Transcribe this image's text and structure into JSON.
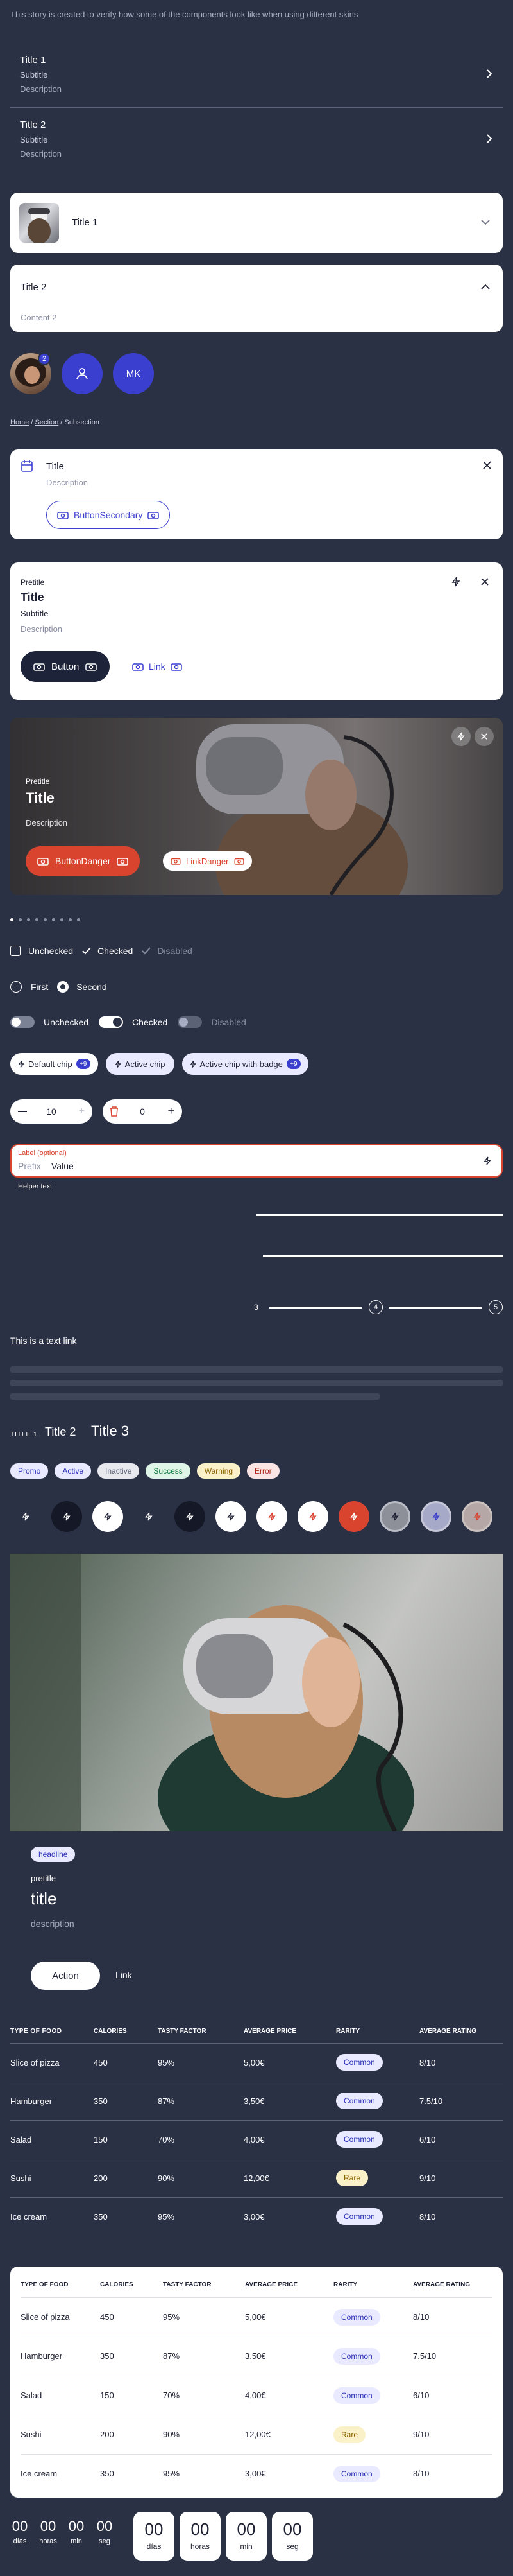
{
  "intro": "This story is created to verify how some of the components look like when using different skins",
  "list_items": [
    {
      "title": "Title 1",
      "subtitle": "Subtitle",
      "description": "Description"
    },
    {
      "title": "Title 2",
      "subtitle": "Subtitle",
      "description": "Description"
    }
  ],
  "accordion_1": {
    "title": "Title 1"
  },
  "accordion_2": {
    "title": "Title 2",
    "content": "Content 2"
  },
  "avatars": {
    "badge": "2",
    "initials": "MK"
  },
  "breadcrumb": {
    "home": "Home",
    "section": "Section",
    "current": "Subsection",
    "sep": "/"
  },
  "callout": {
    "title": "Title",
    "description": "Description",
    "button": "ButtonSecondary"
  },
  "card_white": {
    "pretitle": "Pretitle",
    "title": "Title",
    "subtitle": "Subtitle",
    "description": "Description",
    "button": "Button",
    "link": "Link"
  },
  "card_image": {
    "pretitle": "Pretitle",
    "title": "Title",
    "description": "Description",
    "button": "ButtonDanger",
    "link": "LinkDanger"
  },
  "checkboxes": [
    {
      "label": "Unchecked"
    },
    {
      "label": "Checked"
    },
    {
      "label": "Disabled"
    }
  ],
  "radios": [
    {
      "label": "First"
    },
    {
      "label": "Second"
    }
  ],
  "switches": [
    {
      "label": "Unchecked"
    },
    {
      "label": "Checked"
    },
    {
      "label": "Disabled"
    }
  ],
  "chips": [
    {
      "label": "Default chip",
      "badge": "+9"
    },
    {
      "label": "Active chip"
    },
    {
      "label": "Active chip with badge",
      "badge": "+9"
    }
  ],
  "steppers": [
    {
      "value": "10"
    },
    {
      "value": "0"
    }
  ],
  "text_field": {
    "label": "Label (optional)",
    "prefix": "Prefix",
    "value": "Value",
    "helper": "Helper text"
  },
  "step_numbers": [
    "3",
    "4",
    "5"
  ],
  "text_link": "This is a text link",
  "titles": {
    "t1": "TITLE 1",
    "t2": "Title 2",
    "t3": "Title 3"
  },
  "tags": [
    {
      "label": "Promo",
      "bg": "#e9eaff",
      "fg": "#2a30b8"
    },
    {
      "label": "Active",
      "bg": "#e9eaff",
      "fg": "#2a30b8"
    },
    {
      "label": "Inactive",
      "bg": "#e7e9ef",
      "fg": "#5c6276"
    },
    {
      "label": "Success",
      "bg": "#dff5e8",
      "fg": "#137a3f"
    },
    {
      "label": "Warning",
      "bg": "#fbf1c8",
      "fg": "#8a6400"
    },
    {
      "label": "Error",
      "bg": "#fbe4e4",
      "fg": "#b1261f"
    }
  ],
  "media_card": {
    "headline": "headline",
    "pretitle": "pretitle",
    "title": "title",
    "description": "description",
    "button": "Action",
    "link": "Link"
  },
  "table": {
    "headers": [
      "TYPE OF FOOD",
      "CALORIES",
      "TASTY FACTOR",
      "AVERAGE PRICE",
      "RARITY",
      "AVERAGE RATING"
    ],
    "rows": [
      [
        "Slice of pizza",
        "450",
        "95%",
        "5,00€",
        "Common",
        "8/10"
      ],
      [
        "Hamburger",
        "350",
        "87%",
        "3,50€",
        "Common",
        "7.5/10"
      ],
      [
        "Salad",
        "150",
        "70%",
        "4,00€",
        "Common",
        "6/10"
      ],
      [
        "Sushi",
        "200",
        "90%",
        "12,00€",
        "Rare",
        "9/10"
      ],
      [
        "Ice cream",
        "350",
        "95%",
        "3,00€",
        "Common",
        "8/10"
      ]
    ]
  },
  "countdown": {
    "units": [
      {
        "value": "00",
        "label": "días"
      },
      {
        "value": "00",
        "label": "horas"
      },
      {
        "value": "00",
        "label": "min"
      },
      {
        "value": "00",
        "label": "seg"
      }
    ]
  },
  "colors": {
    "background": "#2b3145",
    "accent": "#3b3fcf",
    "danger": "#d9442f",
    "dark_button": "#1d2338"
  }
}
